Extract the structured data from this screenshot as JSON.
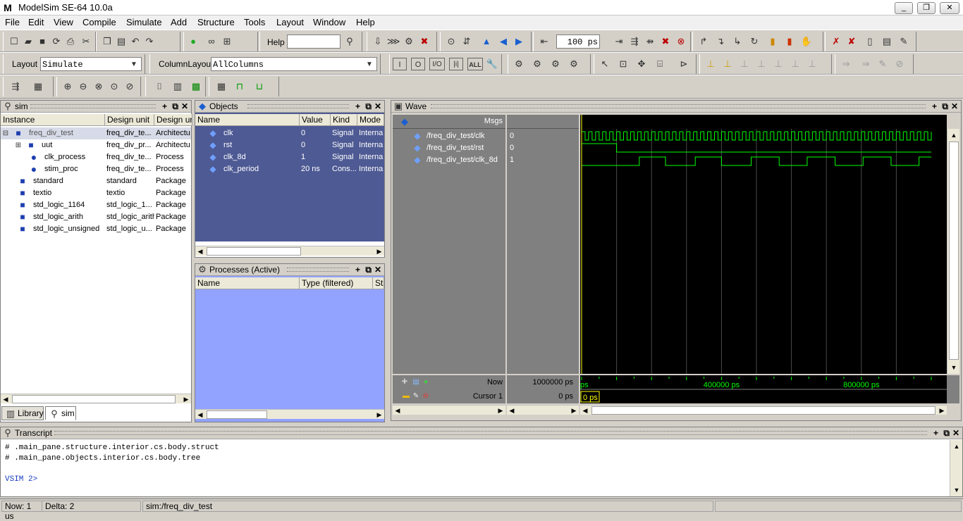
{
  "window": {
    "title": "ModelSim SE-64 10.0a",
    "logo": "M"
  },
  "menu": [
    "File",
    "Edit",
    "View",
    "Compile",
    "Simulate",
    "Add",
    "Structure",
    "Tools",
    "Layout",
    "Window",
    "Help"
  ],
  "toolbar": {
    "help_label": "Help",
    "help_value": "",
    "run_length": "100 ps",
    "layout_label": "Layout",
    "layout_value": "Simulate",
    "column_layout_label": "ColumnLayout",
    "column_layout_value": "AllColumns",
    "mode_buttons": [
      "I",
      "O",
      "I/O",
      "|i|",
      "ALL"
    ]
  },
  "sim_pane": {
    "title": "sim",
    "columns": [
      "Instance",
      "Design unit",
      "Design ur"
    ],
    "rows": [
      {
        "instance": "freq_div_test",
        "unit": "freq_div_te...",
        "type": "Architectu",
        "icon": "square"
      },
      {
        "instance": "uut",
        "unit": "freq_div_pr...",
        "type": "Architectu",
        "icon": "square"
      },
      {
        "instance": "clk_process",
        "unit": "freq_div_te...",
        "type": "Process",
        "icon": "circle"
      },
      {
        "instance": "stim_proc",
        "unit": "freq_div_te...",
        "type": "Process",
        "icon": "circle"
      },
      {
        "instance": "standard",
        "unit": "standard",
        "type": "Package",
        "icon": "square"
      },
      {
        "instance": "textio",
        "unit": "textio",
        "type": "Package",
        "icon": "square"
      },
      {
        "instance": "std_logic_1164",
        "unit": "std_logic_1...",
        "type": "Package",
        "icon": "square"
      },
      {
        "instance": "std_logic_arith",
        "unit": "std_logic_arith",
        "type": "Package",
        "icon": "square"
      },
      {
        "instance": "std_logic_unsigned",
        "unit": "std_logic_u...",
        "type": "Package",
        "icon": "square"
      }
    ],
    "tabs": [
      "Library",
      "sim"
    ]
  },
  "objects_pane": {
    "title": "Objects",
    "columns": [
      "Name",
      "Value",
      "Kind",
      "Mode"
    ],
    "rows": [
      {
        "name": "clk",
        "value": "0",
        "kind": "Signal",
        "mode": "Interna"
      },
      {
        "name": "rst",
        "value": "0",
        "kind": "Signal",
        "mode": "Interna"
      },
      {
        "name": "clk_8d",
        "value": "1",
        "kind": "Signal",
        "mode": "Interna"
      },
      {
        "name": "clk_period",
        "value": "20 ns",
        "kind": "Cons...",
        "mode": "Interna"
      }
    ]
  },
  "processes_pane": {
    "title": "Processes (Active)",
    "columns": [
      "Name",
      "Type (filtered)",
      "Sta"
    ]
  },
  "wave_pane": {
    "title": "Wave",
    "msgs_label": "Msgs",
    "signals": [
      {
        "name": "/freq_div_test/clk",
        "value": "0"
      },
      {
        "name": "/freq_div_test/rst",
        "value": "0"
      },
      {
        "name": "/freq_div_test/clk_8d",
        "value": "1"
      }
    ],
    "now_label": "Now",
    "now_value": "1000000 ps",
    "cursor_label": "Cursor 1",
    "cursor_value": "0 ps",
    "cursor_tag": "0 ps",
    "time_ticks": [
      "ps",
      "400000 ps",
      "800000 ps"
    ],
    "timeline_ps": {
      "start": 0,
      "end": 1000000
    },
    "clk_period_ps": 20000,
    "rst_high_until_ps": 100000,
    "clk8d_edges_ps": [
      165000,
      240000,
      325000,
      400000,
      485000,
      565000,
      645000,
      725000,
      805000,
      885000,
      965000
    ]
  },
  "transcript": {
    "title": "Transcript",
    "lines": [
      "# .main_pane.structure.interior.cs.body.struct",
      "# .main_pane.objects.interior.cs.body.tree"
    ],
    "prompt": "VSIM 2>"
  },
  "statusbar": {
    "now": "Now: 1 us",
    "delta": "Delta: 2",
    "context": "sim:/freq_div_test"
  },
  "colors": {
    "object_bg": "#4e5a94",
    "process_bg": "#92a2ff",
    "wave_green": "#00ff00",
    "cursor_yellow": "#ffff00",
    "signal_diamond": "#3a66d8"
  }
}
